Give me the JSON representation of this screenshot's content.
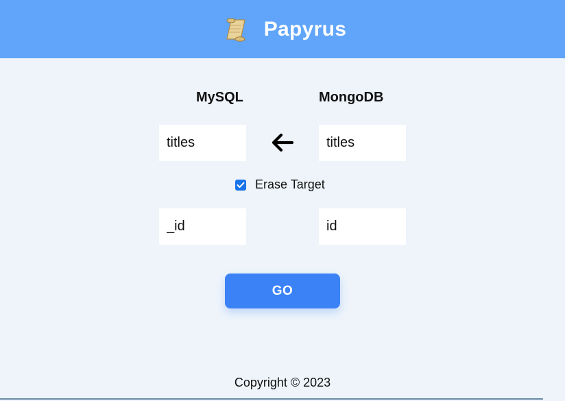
{
  "header": {
    "title": "Papyrus",
    "logo_icon": "scroll-icon"
  },
  "columns": {
    "source_label": "MySQL",
    "target_label": "MongoDB"
  },
  "collections": {
    "mysql_value": "titles",
    "mongodb_value": "titles",
    "direction_icon": "arrow-left-icon"
  },
  "options": {
    "erase_target_label": "Erase Target",
    "erase_target_checked": true
  },
  "keys": {
    "mysql_key": "_id",
    "mongodb_key": "id"
  },
  "actions": {
    "go_label": "GO"
  },
  "footer": {
    "copyright": "Copyright © 2023"
  },
  "colors": {
    "header_bg": "#60a5fa",
    "page_bg": "#eef4fa",
    "button_bg": "#3b82f6",
    "checkbox": "#1a73e8"
  }
}
